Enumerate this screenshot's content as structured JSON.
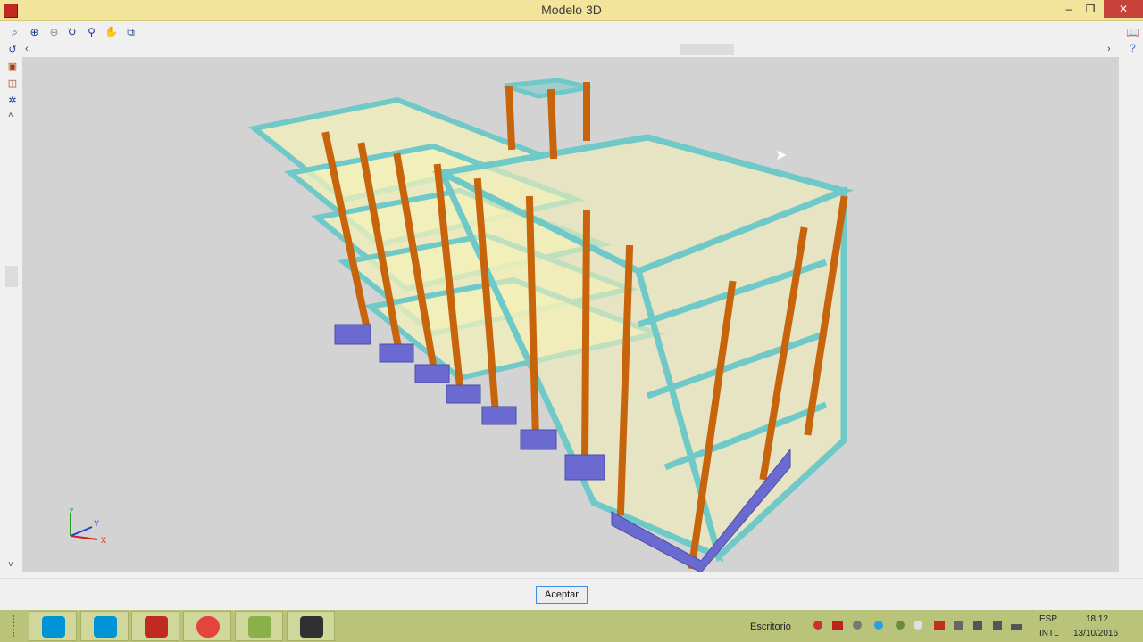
{
  "window": {
    "title": "Modelo 3D",
    "minimize_glyph": "–",
    "restore_glyph": "❐",
    "close_glyph": "✕"
  },
  "toolbar": {
    "icons": [
      "zoom-window-icon",
      "zoom-extents-icon",
      "zoom-previous-icon",
      "rotate-view-icon",
      "zoom-in-icon",
      "pan-hand-icon",
      "view-select-icon"
    ]
  },
  "left_toolbar": {
    "icons": [
      "redo-icon",
      "cube-view-icon",
      "cube-layers-icon",
      "settings-eye-icon"
    ]
  },
  "axes": {
    "x": "X",
    "y": "Y",
    "z": "Z"
  },
  "footer": {
    "accept_label": "Aceptar"
  },
  "taskbar": {
    "apps": [
      "skype-icon",
      "skype-icon",
      "cypecad-icon",
      "chrome-icon",
      "notes-icon",
      "camera-icon"
    ],
    "desktop_label": "Escritorio",
    "language": "ESP",
    "keyboard": "INTL",
    "time": "18:12",
    "date": "13/10/2016"
  },
  "colors": {
    "title_bar": "#f2e49a",
    "viewport_bg": "#d3d3d3",
    "beam": "#6fc9c8",
    "column": "#c8640c",
    "slab": "#f3f0b8",
    "footing": "#6a6ad0",
    "taskbar": "#b9c37a"
  }
}
